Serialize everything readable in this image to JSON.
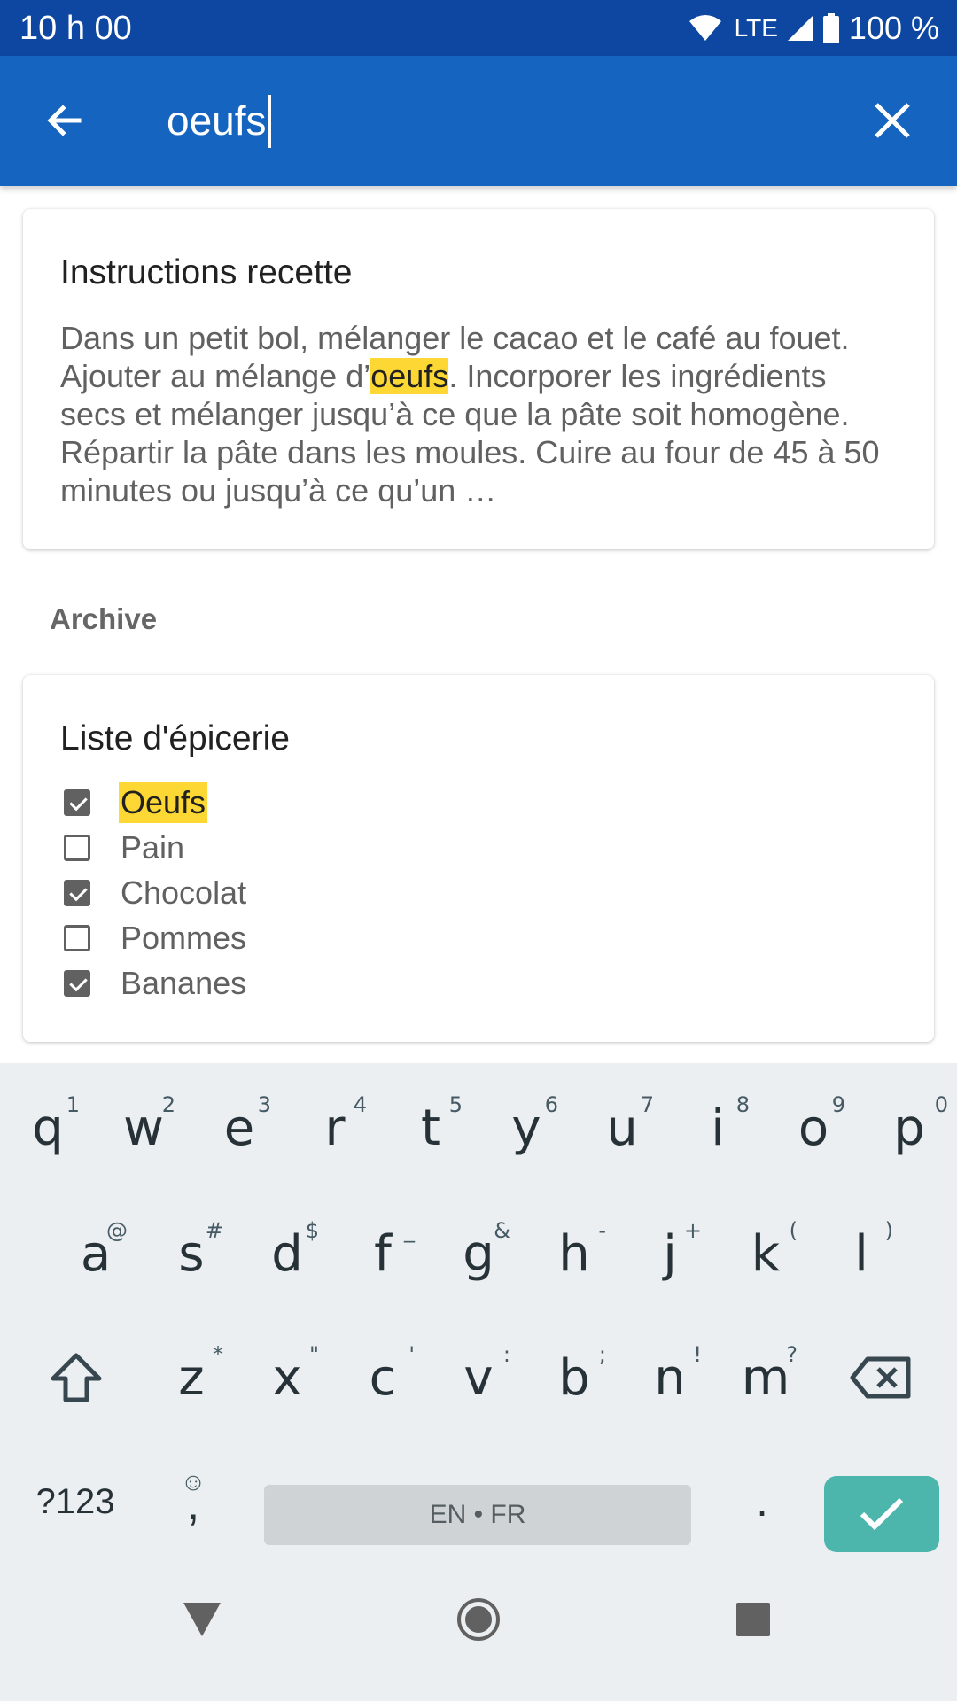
{
  "status_bar": {
    "time": "10 h 00",
    "network": "LTE",
    "battery": "100 %"
  },
  "search": {
    "query": "oeufs"
  },
  "results": {
    "recipe_card": {
      "title": "Instructions recette",
      "body_before": "Dans un petit bol, mélanger le cacao et le café au fouet. Ajouter au mélange d’",
      "body_highlight": "oeufs",
      "body_after": ". Incorporer les ingrédients secs et mélanger jusqu’à ce que la pâte soit homogène. Répartir la pâte dans les moules. Cuire au four de 45 à 50 minutes ou jusqu’à ce qu’un …"
    },
    "section_label": "Archive",
    "list_card": {
      "title": "Liste d'épicerie",
      "items": [
        {
          "label": "Oeufs",
          "checked": true,
          "highlighted": true
        },
        {
          "label": "Pain",
          "checked": false,
          "highlighted": false
        },
        {
          "label": "Chocolat",
          "checked": true,
          "highlighted": false
        },
        {
          "label": "Pommes",
          "checked": false,
          "highlighted": false
        },
        {
          "label": "Bananes",
          "checked": true,
          "highlighted": false
        }
      ]
    }
  },
  "keyboard": {
    "row1": [
      {
        "key": "q",
        "hint": "1"
      },
      {
        "key": "w",
        "hint": "2"
      },
      {
        "key": "e",
        "hint": "3"
      },
      {
        "key": "r",
        "hint": "4"
      },
      {
        "key": "t",
        "hint": "5"
      },
      {
        "key": "y",
        "hint": "6"
      },
      {
        "key": "u",
        "hint": "7"
      },
      {
        "key": "i",
        "hint": "8"
      },
      {
        "key": "o",
        "hint": "9"
      },
      {
        "key": "p",
        "hint": "0"
      }
    ],
    "row2": [
      {
        "key": "a",
        "hint": "@"
      },
      {
        "key": "s",
        "hint": "#"
      },
      {
        "key": "d",
        "hint": "$"
      },
      {
        "key": "f",
        "hint": "_"
      },
      {
        "key": "g",
        "hint": "&"
      },
      {
        "key": "h",
        "hint": "-"
      },
      {
        "key": "j",
        "hint": "+"
      },
      {
        "key": "k",
        "hint": "("
      },
      {
        "key": "l",
        "hint": ")"
      }
    ],
    "row3": [
      {
        "key": "z",
        "hint": "*"
      },
      {
        "key": "x",
        "hint": "\""
      },
      {
        "key": "c",
        "hint": "'"
      },
      {
        "key": "v",
        "hint": ":"
      },
      {
        "key": "b",
        "hint": ";"
      },
      {
        "key": "n",
        "hint": "!"
      },
      {
        "key": "m",
        "hint": "?"
      }
    ],
    "symbols_label": "?123",
    "comma_label": ",",
    "emoji_hint": "☺",
    "space_label": "EN • FR",
    "period_label": ".",
    "enter_color": "#4db6ac"
  },
  "colors": {
    "status_bar": "#0d47a1",
    "app_bar": "#1565c0",
    "highlight": "#fdd835",
    "keyboard_bg": "#eceff1"
  }
}
